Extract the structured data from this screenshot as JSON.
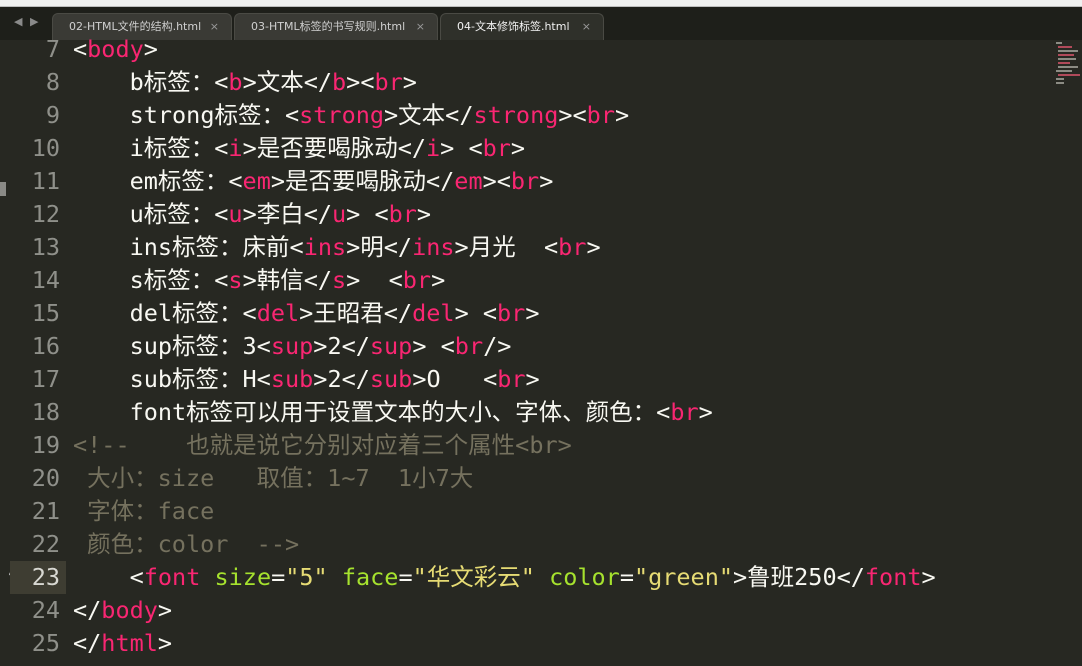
{
  "tabs": [
    {
      "label": "02-HTML文件的结构.html",
      "close": "×",
      "active": false
    },
    {
      "label": "03-HTML标签的书写规则.html",
      "close": "×",
      "active": false
    },
    {
      "label": "04-文本修饰标签.html",
      "close": "×",
      "active": true
    }
  ],
  "nav": {
    "prev": "◀",
    "next": "▶"
  },
  "colors": {
    "background": "#272822",
    "tag": "#f92672",
    "attr": "#a6e22e",
    "string": "#e6db74",
    "comment": "#75715e"
  },
  "lines": [
    {
      "n": "7",
      "tokens": [
        [
          "p",
          "<"
        ],
        [
          "t",
          "body"
        ],
        [
          "p",
          ">"
        ]
      ]
    },
    {
      "n": "8",
      "tokens": [
        [
          "p",
          "    b标签："
        ],
        [
          "p",
          "<"
        ],
        [
          "t",
          "b"
        ],
        [
          "p",
          ">文本</"
        ],
        [
          "t",
          "b"
        ],
        [
          "p",
          "><"
        ],
        [
          "t",
          "br"
        ],
        [
          "p",
          ">"
        ]
      ]
    },
    {
      "n": "9",
      "tokens": [
        [
          "p",
          "    strong标签："
        ],
        [
          "p",
          "<"
        ],
        [
          "t",
          "strong"
        ],
        [
          "p",
          ">文本</"
        ],
        [
          "t",
          "strong"
        ],
        [
          "p",
          "><"
        ],
        [
          "t",
          "br"
        ],
        [
          "p",
          ">"
        ]
      ]
    },
    {
      "n": "10",
      "tokens": [
        [
          "p",
          "    i标签："
        ],
        [
          "p",
          "<"
        ],
        [
          "t",
          "i"
        ],
        [
          "p",
          ">是否要喝脉动</"
        ],
        [
          "t",
          "i"
        ],
        [
          "p",
          "> <"
        ],
        [
          "t",
          "br"
        ],
        [
          "p",
          ">"
        ]
      ]
    },
    {
      "n": "11",
      "tokens": [
        [
          "p",
          "    em标签："
        ],
        [
          "p",
          "<"
        ],
        [
          "t",
          "em"
        ],
        [
          "p",
          ">是否要喝脉动</"
        ],
        [
          "t",
          "em"
        ],
        [
          "p",
          "><"
        ],
        [
          "t",
          "br"
        ],
        [
          "p",
          ">"
        ]
      ]
    },
    {
      "n": "12",
      "tokens": [
        [
          "p",
          "    u标签："
        ],
        [
          "p",
          "<"
        ],
        [
          "t",
          "u"
        ],
        [
          "p",
          ">李白</"
        ],
        [
          "t",
          "u"
        ],
        [
          "p",
          "> <"
        ],
        [
          "t",
          "br"
        ],
        [
          "p",
          ">"
        ]
      ]
    },
    {
      "n": "13",
      "tokens": [
        [
          "p",
          "    ins标签：床前<"
        ],
        [
          "t",
          "ins"
        ],
        [
          "p",
          ">明</"
        ],
        [
          "t",
          "ins"
        ],
        [
          "p",
          ">月光  <"
        ],
        [
          "t",
          "br"
        ],
        [
          "p",
          ">"
        ]
      ]
    },
    {
      "n": "14",
      "tokens": [
        [
          "p",
          "    s标签："
        ],
        [
          "p",
          "<"
        ],
        [
          "t",
          "s"
        ],
        [
          "p",
          ">韩信</"
        ],
        [
          "t",
          "s"
        ],
        [
          "p",
          ">  <"
        ],
        [
          "t",
          "br"
        ],
        [
          "p",
          ">"
        ]
      ]
    },
    {
      "n": "15",
      "tokens": [
        [
          "p",
          "    del标签："
        ],
        [
          "p",
          "<"
        ],
        [
          "t",
          "del"
        ],
        [
          "p",
          ">王昭君</"
        ],
        [
          "t",
          "del"
        ],
        [
          "p",
          "> <"
        ],
        [
          "t",
          "br"
        ],
        [
          "p",
          ">"
        ]
      ]
    },
    {
      "n": "16",
      "tokens": [
        [
          "p",
          "    sup标签：3<"
        ],
        [
          "t",
          "sup"
        ],
        [
          "p",
          ">2</"
        ],
        [
          "t",
          "sup"
        ],
        [
          "p",
          "> <"
        ],
        [
          "t",
          "br"
        ],
        [
          "p",
          "/>"
        ]
      ]
    },
    {
      "n": "17",
      "tokens": [
        [
          "p",
          "    sub标签：H<"
        ],
        [
          "t",
          "sub"
        ],
        [
          "p",
          ">2</"
        ],
        [
          "t",
          "sub"
        ],
        [
          "p",
          ">O   <"
        ],
        [
          "t",
          "br"
        ],
        [
          "p",
          ">"
        ]
      ]
    },
    {
      "n": "18",
      "tokens": [
        [
          "p",
          "    font标签可以用于设置文本的大小、字体、颜色：<"
        ],
        [
          "t",
          "br"
        ],
        [
          "p",
          ">"
        ]
      ]
    },
    {
      "n": "19",
      "tokens": [
        [
          "c",
          "<!--    也就是说它分别对应着三个属性<br>"
        ]
      ]
    },
    {
      "n": "20",
      "tokens": [
        [
          "c",
          " 大小：size   取值：1~7  1小7大"
        ]
      ]
    },
    {
      "n": "21",
      "tokens": [
        [
          "c",
          " 字体：face"
        ]
      ]
    },
    {
      "n": "22",
      "tokens": [
        [
          "c",
          " 颜色：color  -->"
        ]
      ]
    },
    {
      "n": "23",
      "current": true,
      "tokens": [
        [
          "p",
          "    <"
        ],
        [
          "t",
          "font"
        ],
        [
          "p",
          " "
        ],
        [
          "a",
          "size"
        ],
        [
          "p",
          "="
        ],
        [
          "s",
          "\"5\""
        ],
        [
          "p",
          " "
        ],
        [
          "a",
          "face"
        ],
        [
          "p",
          "="
        ],
        [
          "s",
          "\"华文彩云\""
        ],
        [
          "p",
          " "
        ],
        [
          "a",
          "color"
        ],
        [
          "p",
          "="
        ],
        [
          "s",
          "\"green\""
        ],
        [
          "p",
          ">鲁班250</"
        ],
        [
          "t",
          "font"
        ],
        [
          "p",
          ">"
        ]
      ]
    },
    {
      "n": "24",
      "tokens": [
        [
          "p",
          "</"
        ],
        [
          "t",
          "body"
        ],
        [
          "p",
          ">"
        ]
      ]
    },
    {
      "n": "25",
      "tokens": [
        [
          "p",
          "</"
        ],
        [
          "t",
          "html"
        ],
        [
          "p",
          ">"
        ]
      ]
    }
  ],
  "fold_marker": "“”"
}
